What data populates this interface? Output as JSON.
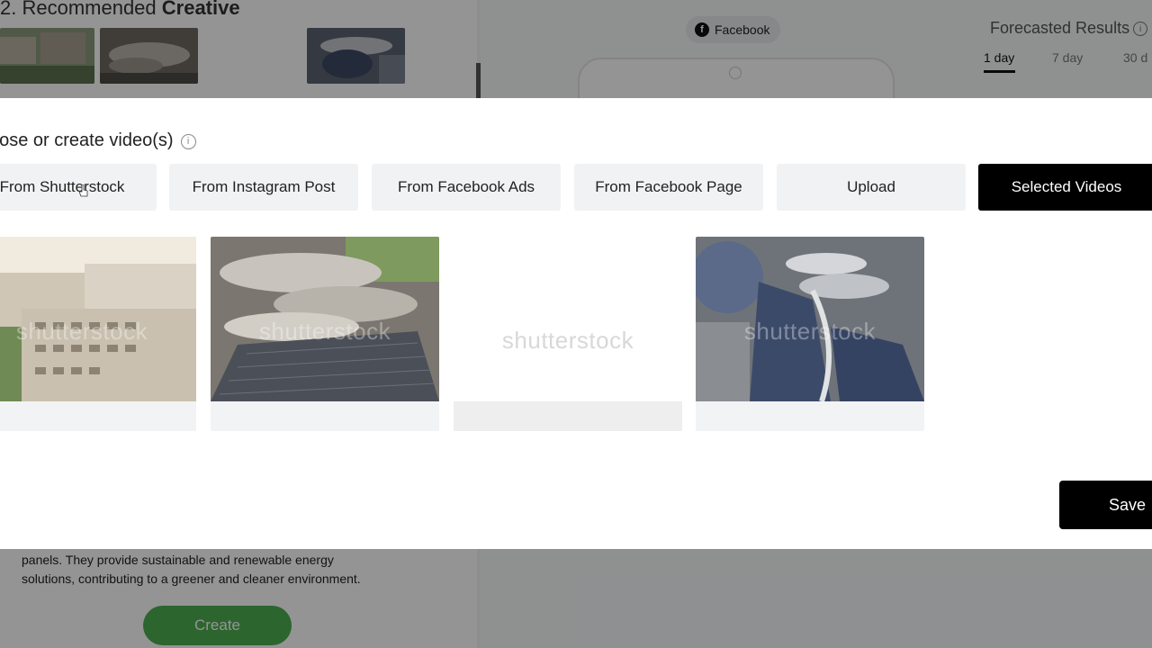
{
  "background": {
    "recommended_title_prefix": "2. Recommended ",
    "recommended_title_bold": "Creative",
    "platform_chip": "Facebook",
    "forecast_title": "Forecasted Results",
    "forecast_tabs": [
      "1 day",
      "7 day",
      "30 d"
    ],
    "description": "panels. They provide sustainable and renewable energy solutions, contributing to a greener and cleaner environment.",
    "create_label": "Create"
  },
  "modal": {
    "title": "oose or create video(s)",
    "tabs": [
      {
        "label": "From Shutterstock"
      },
      {
        "label": "From Instagram Post"
      },
      {
        "label": "From Facebook Ads"
      },
      {
        "label": "From Facebook Page"
      },
      {
        "label": "Upload"
      },
      {
        "label": "Selected Videos"
      }
    ],
    "watermark": "shutterstock",
    "save_label": "Save"
  },
  "colors": {
    "accent_green": "#4caf50",
    "selected_tab": "#000000",
    "overlay": "rgba(0,0,0,0.42)"
  }
}
